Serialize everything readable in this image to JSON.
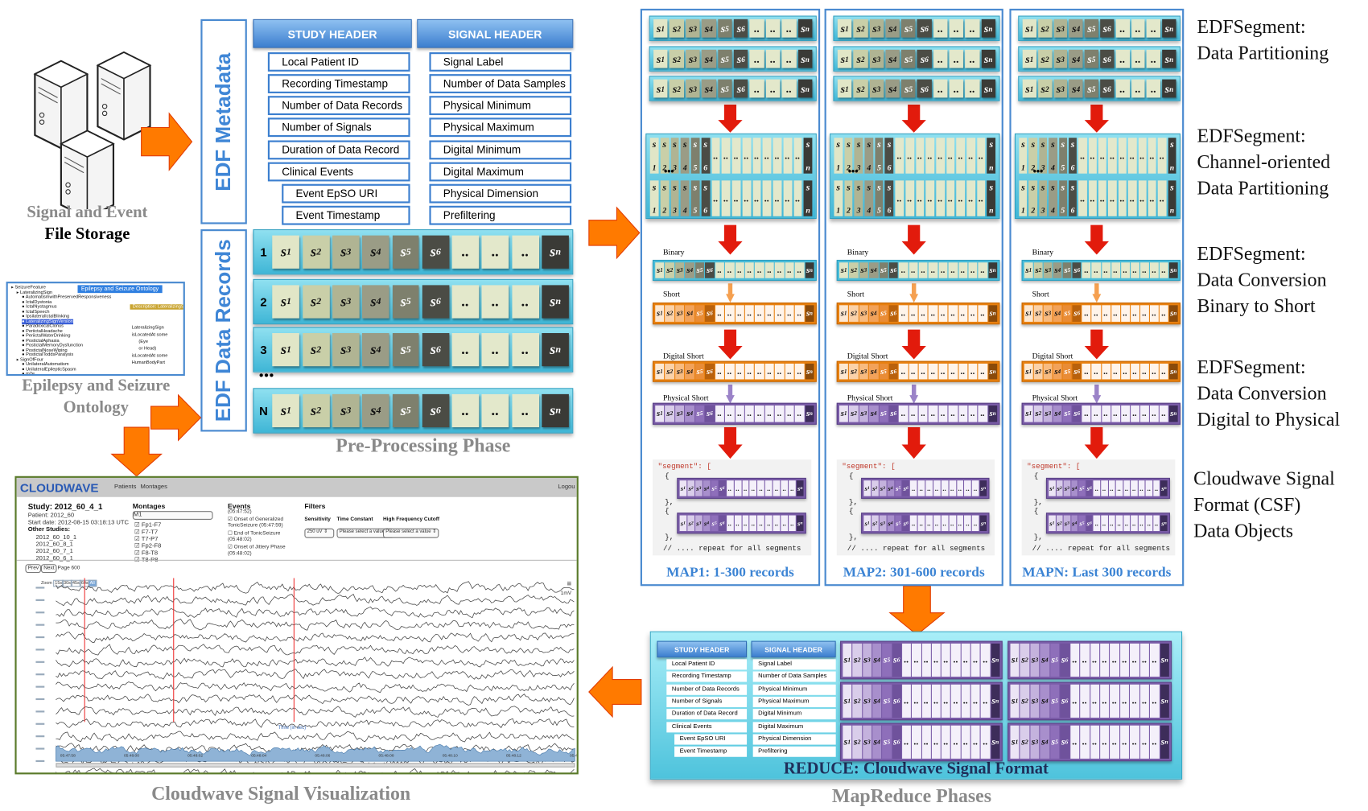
{
  "colors": {
    "accent_blue": "#3f86d6",
    "arrow_orange": "#ff7a00",
    "arrow_red": "#e21b0c",
    "record_cyan": "#3fb6d6",
    "orange_row": "#e8800f",
    "purple_row": "#7a5ca8",
    "reduce_title": "#1f2f5a"
  },
  "segment_cells": {
    "record": [
      {
        "s": "s",
        "sub": "1"
      },
      {
        "s": "s",
        "sub": "2"
      },
      {
        "s": "s",
        "sub": "3"
      },
      {
        "s": "s",
        "sub": "4"
      },
      {
        "s": "s",
        "sub": "5"
      },
      {
        "s": "s",
        "sub": "6"
      },
      {
        "s": "..",
        "sub": ""
      },
      {
        "s": "..",
        "sub": ""
      },
      {
        "s": "..",
        "sub": ""
      },
      {
        "s": "s",
        "sub": "n"
      }
    ],
    "record_colors": [
      "#e1e6c7",
      "#c9cfa8",
      "#b0b493",
      "#9a9c86",
      "#7e806d",
      "#4b4c45",
      "#e3e8cb",
      "#e3e8cb",
      "#e3e8cb",
      "#3a3a36"
    ]
  },
  "storage": {
    "label_line1": "Signal and Event",
    "label_line2": "File Storage",
    "icon": "server-icon"
  },
  "ontology": {
    "window_title": "Epilepsy and Seizure Ontology",
    "tree": [
      "SeizureFeature",
      "LateralizingSign",
      "AutomatismwithPreservedResponsiveness",
      "IctalDystonia",
      "IctalNystagmus",
      "IctalSpeech",
      "IpsilateralIctalBlinking",
      "LateralizingSignVersion",
      "ParadoxicalClonus",
      "PeriictalHeadache",
      "PeriictalWaterDrinking",
      "PostictalAphasia",
      "PostictalMemoryDysfunction",
      "PostictalNoseWiping",
      "PostictalToddsParalysis",
      "SignOfFour",
      "UnilateralAutomatism",
      "UnilateralEpilepticSpasm",
      "m2e"
    ],
    "description_title": "Description: LateralizingSign",
    "axioms": [
      "LateralizingSign",
      "isLocatedAt some",
      "(Eye",
      "or Head)",
      "isLocatedAt some",
      "HumanBodyPart"
    ],
    "caption_line1": "Epilepsy and Seizure",
    "caption_line2": "Ontology"
  },
  "preprocessing": {
    "metadata_label": "EDF Metadata",
    "records_label": "EDF Data Records",
    "study_header": "STUDY HEADER",
    "signal_header": "SIGNAL HEADER",
    "study_fields": [
      "Local Patient ID",
      "Recording Timestamp",
      "Number of Data Records",
      "Number of Signals",
      "Duration of Data Record",
      "Clinical Events",
      "Event EpSO URI",
      "Event Timestamp"
    ],
    "signal_fields": [
      "Signal Label",
      "Number of Data Samples",
      "Physical Minimum",
      "Physical Maximum",
      "Digital Minimum",
      "Digital Maximum",
      "Physical Dimension",
      "Prefiltering"
    ],
    "record_rows": [
      "1",
      "2",
      "3",
      "N"
    ],
    "ellipsis": "•••",
    "caption": "Pre-Processing Phase"
  },
  "mapreduce": {
    "maps": [
      {
        "label": "MAP1: 1-300 records"
      },
      {
        "label": "MAP2: 301-600 records"
      },
      {
        "label": "MAPN: Last 300 records"
      }
    ],
    "stage_labels": {
      "binary": "Binary",
      "short": "Short",
      "digital_short": "Digital Short",
      "physical_short": "Physical Short"
    },
    "code": {
      "open": "\"segment\": [",
      "brace_open": "{",
      "brace_close": "},",
      "comment": "// .... repeat for all segments"
    },
    "right_labels": [
      [
        "EDFSegment:",
        "Data Partitioning"
      ],
      [
        "EDFSegment:",
        "Channel-oriented",
        "Data Partitioning"
      ],
      [
        "EDFSegment:",
        "Data Conversion",
        "Binary to Short"
      ],
      [
        "EDFSegment:",
        "Data Conversion",
        "Digital to Physical"
      ],
      [
        "Cloudwave Signal",
        "Format (CSF)",
        "Data Objects"
      ]
    ],
    "reduce_title": "REDUCE: Cloudwave Signal Format",
    "caption": "MapReduce Phases"
  },
  "cloudwave": {
    "logo": "CLOUDWAVE",
    "nav": [
      "Patients",
      "Montages"
    ],
    "logout": "Logou",
    "study_title": "Study: 2012_60_4_1",
    "patient": "Patient: 2012_60",
    "start_date": "Start date: 2012-08-15 03:18:13 UTC",
    "other_studies_label": "Other Studies:",
    "other_studies": [
      "2012_60_10_1",
      "2012_60_8_1",
      "2012_60_7_1",
      "2012_60_6_1"
    ],
    "montages_label": "Montages",
    "montage_selected": "M1",
    "montage_channels": [
      "Fp1-F7",
      "F7-T7",
      "T7-P7",
      "Fp2-F8",
      "F8-T8",
      "T8-P8"
    ],
    "events_label": "Events",
    "events": [
      "(05:47:52)",
      "☑ Onset of Generalized",
      "TonicSeizure (05:47:59)",
      "☐ End of TonicSeizure",
      "(05:48:02)",
      "☑ Onset of Jittery Phase",
      "(05:48:02)"
    ],
    "filters_label": "Filters",
    "filter_names": [
      "Sensitivity",
      "Time Constant",
      "High Frequency Cutoff"
    ],
    "filter_values": [
      "250 uV",
      "Please select a value",
      "Please select a value"
    ],
    "prev": "Prev",
    "next": "Next",
    "page": "Page 600",
    "zoom_label": "Zoom",
    "zoom_options": [
      "15s",
      "30s",
      "45s",
      "60s",
      "All"
    ],
    "zoom_selected": "All",
    "scale_label": "1mV",
    "x_axis_label": "Time (in sec)",
    "navigator_ticks": [
      "05:47:58",
      "05:48:00",
      "05:48:02",
      "05:48:04",
      "05:48:06",
      "05:48:08",
      "05:48:10",
      "05:48:12",
      "05:48:14"
    ],
    "caption": "Cloudwave Signal Visualization"
  }
}
